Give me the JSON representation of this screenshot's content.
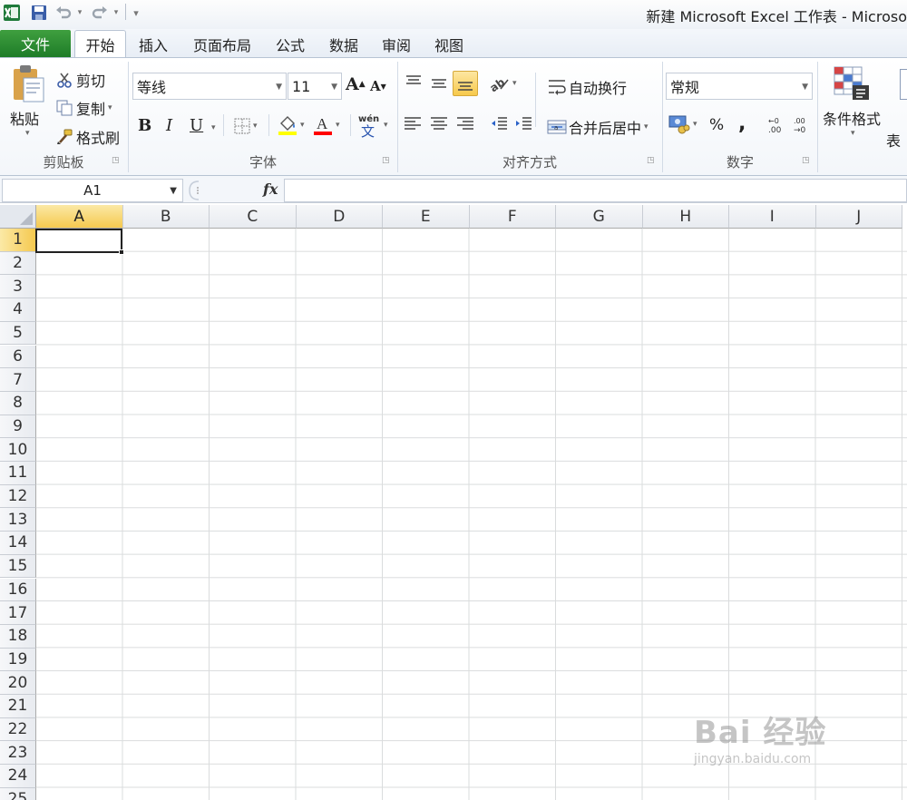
{
  "window": {
    "title": "新建 Microsoft Excel 工作表 - Microso"
  },
  "tabs": {
    "file": "文件",
    "items": [
      "开始",
      "插入",
      "页面布局",
      "公式",
      "数据",
      "审阅",
      "视图"
    ]
  },
  "clipboard": {
    "paste": "粘贴",
    "cut": "剪切",
    "copy": "复制",
    "format_painter": "格式刷",
    "group": "剪贴板"
  },
  "font": {
    "name": "等线",
    "size": "11",
    "bold": "B",
    "italic": "I",
    "underline": "U",
    "group": "字体"
  },
  "alignment": {
    "wrap_text": "自动换行",
    "merge_center": "合并后居中",
    "group": "对齐方式"
  },
  "number": {
    "format": "常规",
    "percent": "%",
    "comma": ",",
    "group": "数字"
  },
  "styles": {
    "conditional_format": "条件格式",
    "table_partial": "表"
  },
  "formula_bar": {
    "name_box": "A1",
    "fx": "fx",
    "value": ""
  },
  "sheet": {
    "columns": [
      "A",
      "B",
      "C",
      "D",
      "E",
      "F",
      "G",
      "H",
      "I",
      "J"
    ],
    "rows": [
      "1",
      "2",
      "3",
      "4",
      "5",
      "6",
      "7",
      "8",
      "9",
      "10",
      "11",
      "12",
      "13",
      "14",
      "15",
      "16",
      "17",
      "18",
      "19",
      "20",
      "21",
      "22",
      "23",
      "24",
      "25"
    ],
    "active_cell": "A1"
  },
  "watermark": {
    "main": "Bai 经验",
    "url": "jingyan.baidu.com"
  },
  "colors": {
    "file_tab": "#2a8a34",
    "selected_header": "#f5c94f",
    "fill_color_bar": "#ffff00",
    "font_color_bar": "#ff0000",
    "gridline": "#dadcdd"
  }
}
